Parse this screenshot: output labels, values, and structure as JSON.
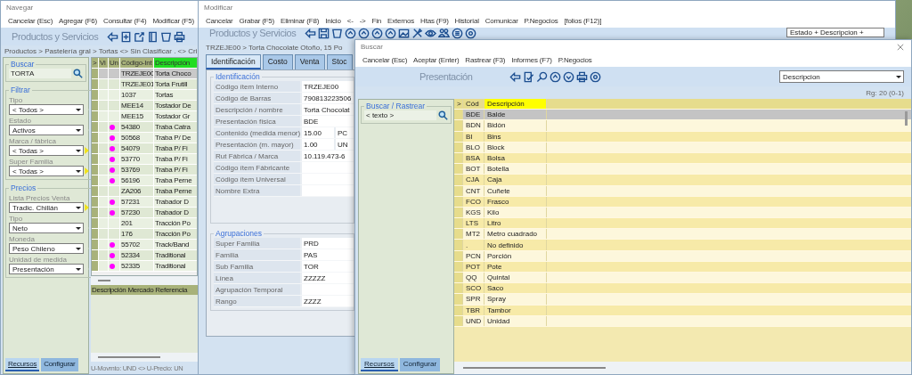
{
  "navegar": {
    "title": "Navegar",
    "menu": [
      "Cancelar (Esc)",
      "Agregar (F6)",
      "Consultar (F4)",
      "Modificar (F5)"
    ],
    "toolbar_title": "Productos y Servicios",
    "breadcrumb": "Productos > Pastelería gral > Tortas <> Sin Clasificar . <> Cri",
    "search": {
      "title": "Buscar",
      "value": "TORTA"
    },
    "filter_groups": [
      {
        "title": "Filtrar",
        "fields": [
          {
            "label": "Tipo",
            "value": "< Todos >",
            "more": false
          },
          {
            "label": "Estado",
            "value": "Activos",
            "more": false
          },
          {
            "label": "Marca / fábrica",
            "value": "< Todas >",
            "more": true
          },
          {
            "label": "Super Familia",
            "value": "< Todas >",
            "more": true
          }
        ]
      },
      {
        "title": "Precios",
        "fields": [
          {
            "label": "Lista Precios Venta",
            "value": "Tradic. Chillán",
            "more": true
          },
          {
            "label": "Tipo",
            "value": "Neto",
            "more": false
          },
          {
            "label": "Moneda",
            "value": "Peso Chileno",
            "more": false
          },
          {
            "label": "Unidad de medida",
            "value": "Presentación",
            "more": false
          }
        ]
      }
    ],
    "grid": {
      "columns": [
        {
          "label": ">",
          "sorted": false
        },
        {
          "label": "Vi",
          "sorted": false
        },
        {
          "label": "Un",
          "sorted": false
        },
        {
          "label": "Código-Int",
          "sorted": false
        },
        {
          "label": "Descripción",
          "sorted": true
        }
      ],
      "rows": [
        {
          "code": "TRZEJE00",
          "description": "Torta Choco",
          "flag": false,
          "selected": true
        },
        {
          "code": "TRZEJE01",
          "description": "Torta Frutill",
          "flag": false,
          "selected": false
        },
        {
          "code": "1037",
          "description": "Tortas",
          "flag": false,
          "selected": false
        },
        {
          "code": "MEE14",
          "description": "Tostador De",
          "flag": false,
          "selected": false
        },
        {
          "code": "MEE15",
          "description": "Tostador Gr",
          "flag": false,
          "selected": false
        },
        {
          "code": "54380",
          "description": "Traba Catra",
          "flag": true,
          "selected": false
        },
        {
          "code": "50568",
          "description": "Traba P/ De",
          "flag": true,
          "selected": false
        },
        {
          "code": "54079",
          "description": "Traba P/ Fi",
          "flag": true,
          "selected": false
        },
        {
          "code": "53770",
          "description": "Traba P/ Fi",
          "flag": true,
          "selected": false
        },
        {
          "code": "53769",
          "description": "Traba P/ Fi",
          "flag": true,
          "selected": false
        },
        {
          "code": "56196",
          "description": "Traba Perne",
          "flag": true,
          "selected": false
        },
        {
          "code": "ZA206",
          "description": "Traba Perne",
          "flag": false,
          "selected": false
        },
        {
          "code": "57231",
          "description": "Trabador D",
          "flag": true,
          "selected": false
        },
        {
          "code": "57230",
          "description": "Trabador D",
          "flag": true,
          "selected": false
        },
        {
          "code": "201",
          "description": "Tracción Po",
          "flag": false,
          "selected": false
        },
        {
          "code": "176",
          "description": "Tracción Po",
          "flag": false,
          "selected": false
        },
        {
          "code": "55702",
          "description": "Track/Band",
          "flag": true,
          "selected": false
        },
        {
          "code": "52334",
          "description": "Traditional",
          "flag": true,
          "selected": false
        },
        {
          "code": "52335",
          "description": "Traditional",
          "flag": true,
          "selected": false
        }
      ]
    },
    "detail_header": "Descripción Mercado Referencia",
    "status": "U-Movmto: UND <> U-Precio: UN",
    "bottom_tabs": [
      {
        "label": "Recursos",
        "selected": true
      },
      {
        "label": "Configurar",
        "selected": false
      }
    ]
  },
  "modificar": {
    "title": "Modificar",
    "menu": [
      "Cancelar",
      "Grabar (F5)",
      "Eliminar (F8)",
      "Inicio",
      "<-",
      "->",
      "Fin",
      "Externos",
      "Htas (F9)",
      "Historial",
      "Comunicar",
      "P.Negocios",
      "[folios (F12)]"
    ],
    "toolbar_title": "Productos y Servicios",
    "sort_select": "Estado + Descripcion +",
    "breadcrumb": "TRZEJE00 > Torta Chocolate Otoño, 15 Po",
    "tabs": [
      {
        "label": "Identificación",
        "selected": true
      },
      {
        "label": "Costo",
        "selected": false
      },
      {
        "label": "Venta",
        "selected": false
      },
      {
        "label": "Stoc",
        "selected": false
      }
    ],
    "groups": [
      {
        "title": "Identificación",
        "fields": [
          {
            "label": "Código ítem Interno",
            "values": [
              "TRZEJE00"
            ]
          },
          {
            "label": "Código de Barras",
            "values": [
              "790813223506"
            ]
          },
          {
            "label": "Descripción / nombre",
            "values": [
              "Torta Chocolat"
            ]
          },
          {
            "label": "Presentación física",
            "values": [
              "BDE"
            ]
          },
          {
            "label": "Contenido (medida menor)",
            "values": [
              "15.00",
              "PC"
            ]
          },
          {
            "label": "Presentación (m. mayor)",
            "values": [
              "1.00",
              "UN"
            ]
          },
          {
            "label": "Rut Fábrica / Marca",
            "values": [
              "10.119.473-6"
            ]
          },
          {
            "label": "Código ítem Fábricante"
          },
          {
            "label": "Código ítem Universal"
          },
          {
            "label": "Nombre Extra"
          }
        ]
      },
      {
        "title": "Agrupaciones",
        "fields": [
          {
            "label": "Super Familia",
            "values": [
              "PRD"
            ]
          },
          {
            "label": "Familia",
            "values": [
              "PAS"
            ]
          },
          {
            "label": "Sub Familia",
            "values": [
              "TOR"
            ]
          },
          {
            "label": "Línea",
            "values": [
              "ZZZZZ"
            ]
          },
          {
            "label": "Agrupación Temporal"
          },
          {
            "label": "Rango",
            "values": [
              "ZZZZ"
            ]
          }
        ]
      }
    ]
  },
  "buscar": {
    "title": "Buscar",
    "menu": [
      "Cancelar (Esc)",
      "Aceptar (Enter)",
      "Rastrear (F3)",
      "Informes (F7)",
      "P.Negocios"
    ],
    "toolbar_title": "Presentación",
    "order_select": "Descripcion",
    "record_count": "Rg: 20 (0-1)",
    "search": {
      "title": "Buscar / Rastrear",
      "placeholder": "< texto >"
    },
    "grid": {
      "columns": [
        {
          "label": ">",
          "sorted": false
        },
        {
          "label": "Cód",
          "sorted": false
        },
        {
          "label": "Descripción",
          "sorted": true
        }
      ],
      "rows": [
        {
          "code": "BDE",
          "description": "Balde",
          "selected": true
        },
        {
          "code": "BDN",
          "description": "Bidón",
          "selected": false
        },
        {
          "code": "BI",
          "description": "Bins",
          "selected": false
        },
        {
          "code": "BLO",
          "description": "Block",
          "selected": false
        },
        {
          "code": "BSA",
          "description": "Bolsa",
          "selected": false
        },
        {
          "code": "BOT",
          "description": "Botella",
          "selected": false
        },
        {
          "code": "CJA",
          "description": "Caja",
          "selected": false
        },
        {
          "code": "CNT",
          "description": "Cuñete",
          "selected": false
        },
        {
          "code": "FCO",
          "description": "Frasco",
          "selected": false
        },
        {
          "code": "KGS",
          "description": "Kilo",
          "selected": false
        },
        {
          "code": "LTS",
          "description": "Litro",
          "selected": false
        },
        {
          "code": "MT2",
          "description": "Metro cuadrado",
          "selected": false
        },
        {
          "code": ".",
          "description": "No definido",
          "selected": false
        },
        {
          "code": "PCN",
          "description": "Porción",
          "selected": false
        },
        {
          "code": "POT",
          "description": "Pote",
          "selected": false
        },
        {
          "code": "QQ",
          "description": "Quintal",
          "selected": false
        },
        {
          "code": "SCO",
          "description": "Saco",
          "selected": false
        },
        {
          "code": "SPR",
          "description": "Spray",
          "selected": false
        },
        {
          "code": "TBR",
          "description": "Tambor",
          "selected": false
        },
        {
          "code": "UND",
          "description": "Unidad",
          "selected": false
        }
      ]
    },
    "bottom_tabs": [
      {
        "label": "Recursos",
        "selected": true
      },
      {
        "label": "Configurar",
        "selected": false
      }
    ]
  }
}
